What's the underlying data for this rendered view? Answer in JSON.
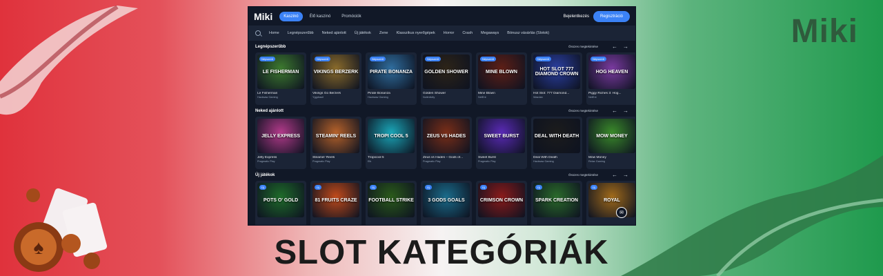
{
  "brand": "Miki",
  "headline": "SLOT KATEGÓRIÁK",
  "app": {
    "logo": "Miki",
    "nav": [
      {
        "label": "Kaszinó",
        "active": true
      },
      {
        "label": "Élő kaszinó",
        "active": false
      },
      {
        "label": "Promóciók",
        "active": false
      }
    ],
    "login_label": "Bejelentkezés",
    "register_label": "Regisztráció",
    "categories": [
      "Home",
      "Legnépszerűbb",
      "Neked ajánlott",
      "Új játékok",
      "Zene",
      "Klasszikus nyerőgépek",
      "Horror",
      "Crash",
      "Megaways",
      "Bónusz vásárlás (Slotok)"
    ],
    "show_all_label": "Összes megtekintése",
    "sections": [
      {
        "title": "Legnépszerűbb",
        "badge": "Népszerű",
        "games": [
          {
            "name": "Le Fisherman",
            "provider": "Hacksaw Gaming",
            "art": "LE FISHERMAN"
          },
          {
            "name": "Vikings Go Berzerk",
            "provider": "Yggdrasil",
            "art": "VIKINGS BERZERK"
          },
          {
            "name": "Pirate Bonanza",
            "provider": "Hacksaw Gaming",
            "art": "PIRATE BONANZA"
          },
          {
            "name": "Golden Shower",
            "provider": "Nolimitcity",
            "art": "GOLDEN SHOWER"
          },
          {
            "name": "Mine Blown",
            "provider": "NetEnt",
            "art": "MINE BLOWN"
          },
          {
            "name": "Hot Slot: 777 Diamond...",
            "provider": "Wazdan",
            "art": "HOT SLOT 777 DIAMOND CROWN"
          },
          {
            "name": "Piggy Riches 3: Hog...",
            "provider": "NetEnt",
            "art": "HOG HEAVEN"
          }
        ]
      },
      {
        "title": "Neked ajánlott",
        "badge": "",
        "games": [
          {
            "name": "Jelly Express",
            "provider": "Pragmatic Play",
            "art": "JELLY EXPRESS"
          },
          {
            "name": "Steamin' Reels",
            "provider": "Pragmatic Play",
            "art": "STEAMIN' REELS"
          },
          {
            "name": "Tropicool 5",
            "provider": "Elk",
            "art": "TROPI COOL 5"
          },
          {
            "name": "Zeus vs Hades – Gods of...",
            "provider": "Pragmatic Play",
            "art": "ZEUS VS HADES"
          },
          {
            "name": "Sweet Burst",
            "provider": "Pragmatic Play",
            "art": "SWEET BURST"
          },
          {
            "name": "Deal With Death",
            "provider": "Hacksaw Gaming",
            "art": "DEAL WITH DEATH"
          },
          {
            "name": "Mow Money",
            "provider": "Relax Gaming",
            "art": "MOW MONEY"
          }
        ]
      },
      {
        "title": "Új játékok",
        "badge": "Új",
        "games": [
          {
            "name": "",
            "provider": "",
            "art": "POTS O' GOLD"
          },
          {
            "name": "",
            "provider": "",
            "art": "81 FRUITS CRAZE"
          },
          {
            "name": "",
            "provider": "",
            "art": "FOOTBALL STRIKE"
          },
          {
            "name": "",
            "provider": "",
            "art": "3 GODS GOALS"
          },
          {
            "name": "",
            "provider": "",
            "art": "CRIMSON CROWN"
          },
          {
            "name": "",
            "provider": "",
            "art": "SPARK CREATION"
          },
          {
            "name": "",
            "provider": "",
            "art": "ROYAL"
          }
        ]
      }
    ]
  },
  "colors": {
    "accent": "#3b82f6",
    "app_bg": "#111827",
    "thumbs": [
      [
        "#3d7a2f",
        "#8a6b2b",
        "#2f6d9e",
        "#2d2418",
        "#5e1f16",
        "#2a3ea0",
        "#7a3aa0"
      ],
      [
        "#b23a8a",
        "#b6622a",
        "#1aa6b8",
        "#7a2e18",
        "#5a2ab6",
        "#1c1c1c",
        "#3a8a2a"
      ],
      [
        "#1e6b2a",
        "#c04a1a",
        "#2a5a1a",
        "#1a6b8a",
        "#8a1a1a",
        "#2a6a2a",
        "#a06a1a"
      ]
    ]
  }
}
